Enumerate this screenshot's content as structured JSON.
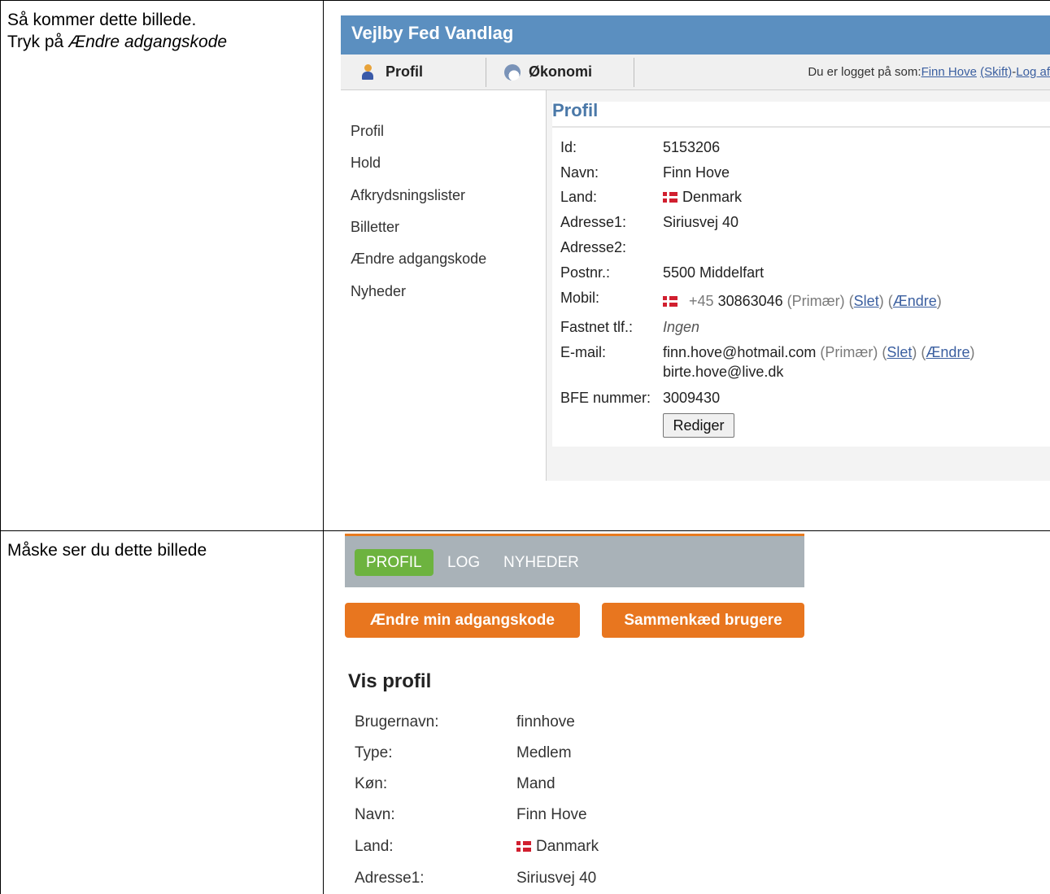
{
  "row1": {
    "instruction_line1": "Så kommer dette billede.",
    "instruction_line2_prefix": "Tryk på ",
    "instruction_line2_emph": "Ændre adgangskode"
  },
  "row2": {
    "instruction": "Måske ser du dette billede"
  },
  "shot1": {
    "app_title": "Vejlby Fed Vandlag",
    "tabs": [
      "Profil",
      "Økonomi"
    ],
    "login": {
      "prefix": "Du er logget på som: ",
      "user": "Finn Hove",
      "switch": "(Skift)",
      "sep": " - ",
      "logout": "Log af"
    },
    "sidebar": [
      "Profil",
      "Hold",
      "Afkrydsningslister",
      "Billetter",
      "Ændre adgangskode",
      "Nyheder"
    ],
    "panel_title": "Profil",
    "fields": {
      "id_label": "Id:",
      "id": "5153206",
      "name_label": "Navn:",
      "name": "Finn Hove",
      "country_label": "Land:",
      "country": "Denmark",
      "addr1_label": "Adresse1:",
      "addr1": "Siriusvej 40",
      "addr2_label": "Adresse2:",
      "zip_label": "Postnr.:",
      "zip": "5500 Middelfart",
      "mobile_label": "Mobil:",
      "mobile_cc": "+45",
      "mobile_number": "30863046",
      "primary": "(Primær)",
      "delete": "Slet",
      "change": "Ændre",
      "landline_label": "Fastnet tlf.:",
      "landline": "Ingen",
      "email_label": "E-mail:",
      "email1": "finn.hove@hotmail.com",
      "email2": "birte.hove@live.dk",
      "bfe_label": "BFE nummer:",
      "bfe": "3009430"
    },
    "edit_button": "Rediger"
  },
  "shot2": {
    "tabs": [
      "PROFIL",
      "LOG",
      "NYHEDER"
    ],
    "change_password_button": "Ændre min adgangskode",
    "link_users_button": "Sammenkæd brugere",
    "heading": "Vis profil",
    "rows": [
      {
        "label": "Brugernavn:",
        "value": "finnhove"
      },
      {
        "label": "Type:",
        "value": "Medlem"
      },
      {
        "label": "Køn:",
        "value": "Mand"
      },
      {
        "label": "Navn:",
        "value": "Finn Hove"
      },
      {
        "label": "Land:",
        "value": "Danmark"
      },
      {
        "label": "Adresse1:",
        "value": "Siriusvej 40"
      }
    ]
  },
  "colors": {
    "header_blue": "#5b8fc0",
    "title_blue": "#4a78a8",
    "active_green": "#6db33f",
    "action_orange": "#e8761f",
    "nav_gray": "#a9b2b8"
  }
}
